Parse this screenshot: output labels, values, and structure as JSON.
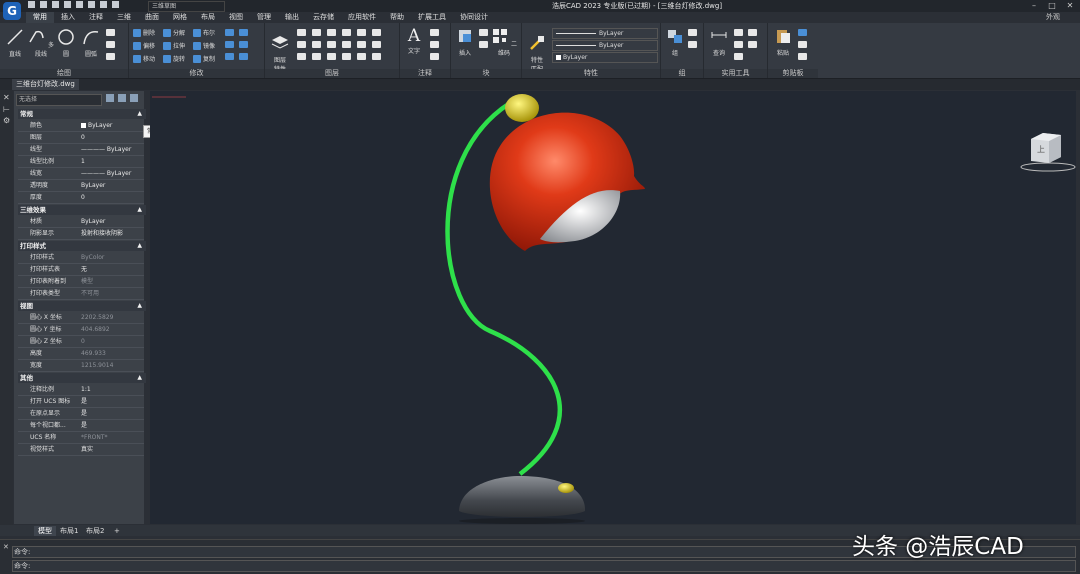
{
  "app": {
    "logo_letter": "G",
    "workspace": "三维草图",
    "title": "浩辰CAD 2023 专业版(已过期) - [三维台灯修改.dwg]",
    "appearance_label": "外观",
    "accent": "#1f63b8"
  },
  "menu": [
    "常用",
    "插入",
    "注释",
    "三维",
    "曲面",
    "网格",
    "布局",
    "视图",
    "管理",
    "输出",
    "云存储",
    "应用软件",
    "帮助",
    "扩展工具",
    "协同设计"
  ],
  "ribbon": {
    "draw": {
      "title": "绘图",
      "line": "直线",
      "polyline": "多段线",
      "circle": "圆",
      "arc": "圆弧"
    },
    "modify": {
      "title": "修改",
      "items": [
        "删除",
        "分解",
        "布尔",
        "偏移",
        "拉伸",
        "镜像",
        "移动",
        "旋转",
        "复制"
      ]
    },
    "layers": {
      "title": "图层",
      "props": "图层\n特性"
    },
    "annotation": {
      "title": "注释",
      "text": "文字"
    },
    "block": {
      "title": "块",
      "insert": "插入",
      "qrcode": "二维码"
    },
    "properties": {
      "title": "特性",
      "match": "特性\n匹配",
      "color": "ByLayer",
      "linetype": "ByLayer",
      "lineweight": "ByLayer",
      "transparency": "ByLayer"
    },
    "group": {
      "title": "组",
      "label": "组"
    },
    "utilities": {
      "title": "实用工具",
      "query": "查询"
    },
    "clipboard": {
      "title": "剪贴板",
      "paste": "粘贴"
    }
  },
  "document_tab": "三维台灯修改.dwg",
  "palette": {
    "selection": "无选择",
    "sections": [
      {
        "title": "常规",
        "rows": [
          {
            "k": "颜色",
            "v": "ByLayer",
            "swatch": true
          },
          {
            "k": "图层",
            "v": "0"
          },
          {
            "k": "线型",
            "v": "———— ByLayer"
          },
          {
            "k": "线型比例",
            "v": "1"
          },
          {
            "k": "线宽",
            "v": "———— ByLayer"
          },
          {
            "k": "透明度",
            "v": "ByLayer"
          },
          {
            "k": "厚度",
            "v": "0"
          }
        ]
      },
      {
        "title": "三维效果",
        "rows": [
          {
            "k": "材质",
            "v": "ByLayer"
          },
          {
            "k": "阴影显示",
            "v": "投射和接收阴影"
          }
        ]
      },
      {
        "title": "打印样式",
        "rows": [
          {
            "k": "打印样式",
            "v": "ByColor",
            "dim": true
          },
          {
            "k": "打印样式表",
            "v": "无"
          },
          {
            "k": "打印表附着到",
            "v": "模型",
            "dim": true
          },
          {
            "k": "打印表类型",
            "v": "不可用",
            "dim": true
          }
        ]
      },
      {
        "title": "视图",
        "rows": [
          {
            "k": "圆心 X 坐标",
            "v": "2202.5829",
            "dim": true
          },
          {
            "k": "圆心 Y 坐标",
            "v": "404.6892",
            "dim": true
          },
          {
            "k": "圆心 Z 坐标",
            "v": "0",
            "dim": true
          },
          {
            "k": "高度",
            "v": "469.933",
            "dim": true
          },
          {
            "k": "宽度",
            "v": "1215.9014",
            "dim": true
          }
        ]
      },
      {
        "title": "其他",
        "rows": [
          {
            "k": "注释比例",
            "v": "1:1"
          },
          {
            "k": "打开 UCS 图标",
            "v": "是"
          },
          {
            "k": "在原点显示",
            "v": "是"
          },
          {
            "k": "每个视口都...",
            "v": "是"
          },
          {
            "k": "UCS 名称",
            "v": "*FRONT*",
            "dim": true
          },
          {
            "k": "视觉样式",
            "v": "真实"
          }
        ]
      }
    ],
    "tooltip": "常规"
  },
  "navcube_face": "上",
  "layout_tabs": [
    "模型",
    "布局1",
    "布局2",
    "+"
  ],
  "command": {
    "line1": "命令:",
    "line2": "命令:"
  },
  "watermark": "头条 @浩辰CAD",
  "colors": {
    "stem": "#2ee04a",
    "shade": "#d42a10",
    "base": "#5a5e63",
    "knob": "#e8d20e"
  }
}
